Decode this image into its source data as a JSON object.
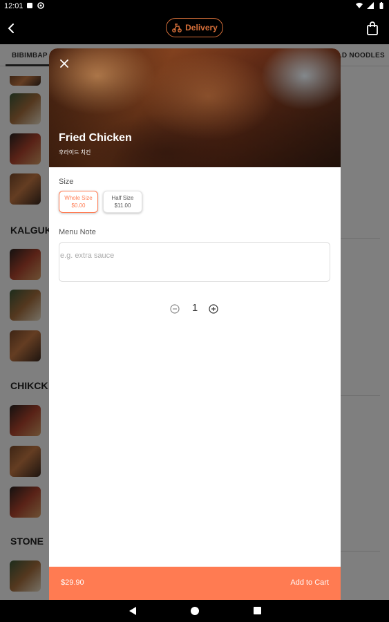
{
  "status_bar": {
    "time": "12:01"
  },
  "app_bar": {
    "delivery_label": "Delivery"
  },
  "background": {
    "tabs": {
      "first": "BIBIMBAP",
      "last": "COLD NOODLES"
    },
    "sections": [
      "KALGUK",
      "CHIKCK",
      "STONE"
    ]
  },
  "modal": {
    "title": "Fried Chicken",
    "subtitle": "후라이드 치킨",
    "size_label": "Size",
    "sizes": [
      {
        "name": "Whole Size",
        "price": "$0.00",
        "selected": true
      },
      {
        "name": "Half Size",
        "price": "$11.00",
        "selected": false
      }
    ],
    "note_label": "Menu Note",
    "note_placeholder": "e.g. extra sauce",
    "quantity": "1",
    "total_price": "$29.90",
    "add_to_cart_label": "Add to Cart"
  },
  "colors": {
    "accent": "#ff7b52",
    "delivery": "#d8703a"
  }
}
